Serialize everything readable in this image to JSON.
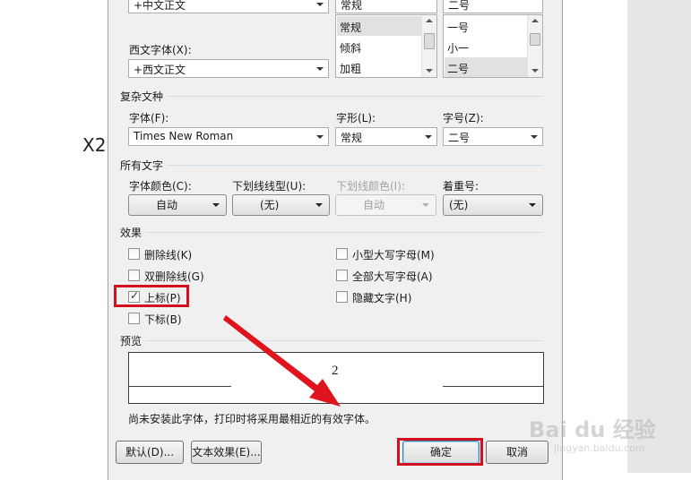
{
  "side_label": "X2",
  "chinese_font": {
    "label": "",
    "value": "+中文正文"
  },
  "western_font": {
    "label": "西文字体(X):",
    "value": "+西文正文"
  },
  "style_list": {
    "header_value": "常规",
    "items": [
      "常规",
      "倾斜",
      "加粗"
    ],
    "selected": "常规"
  },
  "size_list": {
    "header_value": "二号",
    "items": [
      "一号",
      "小一",
      "二号"
    ],
    "selected": "二号"
  },
  "complex_section": {
    "title": "复杂文种",
    "font_label": "字体(F):",
    "font_value": "Times New Roman",
    "style_label": "字形(L):",
    "style_value": "常规",
    "size_label": "字号(Z):",
    "size_value": "二号"
  },
  "all_text_section": {
    "title": "所有文字",
    "color_label": "字体颜色(C):",
    "color_value": "自动",
    "underline_type_label": "下划线线型(U):",
    "underline_type_value": "(无)",
    "underline_color_label": "下划线颜色(I):",
    "underline_color_value": "自动",
    "emphasis_label": "着重号:",
    "emphasis_value": "(无)"
  },
  "effects_section": {
    "title": "效果",
    "left": [
      {
        "label": "删除线(K)",
        "checked": false
      },
      {
        "label": "双删除线(G)",
        "checked": false
      },
      {
        "label": "上标(P)",
        "checked": true
      },
      {
        "label": "下标(B)",
        "checked": false
      }
    ],
    "right": [
      {
        "label": "小型大写字母(M)",
        "checked": false
      },
      {
        "label": "全部大写字母(A)",
        "checked": false
      },
      {
        "label": "隐藏文字(H)",
        "checked": false
      }
    ]
  },
  "preview_section": {
    "title": "预览",
    "sample_text": "2",
    "note": "尚未安装此字体，打印时将采用最相近的有效字体。"
  },
  "buttons": {
    "default": "默认(D)...",
    "text_effects": "文本效果(E)...",
    "ok": "确定",
    "cancel": "取消"
  },
  "watermark": {
    "logo_text": "Bai du 经验",
    "url": "jingyan.baidu.com"
  },
  "colors": {
    "highlight_red": "#d40f1e",
    "arrow_red": "#e0141c"
  }
}
